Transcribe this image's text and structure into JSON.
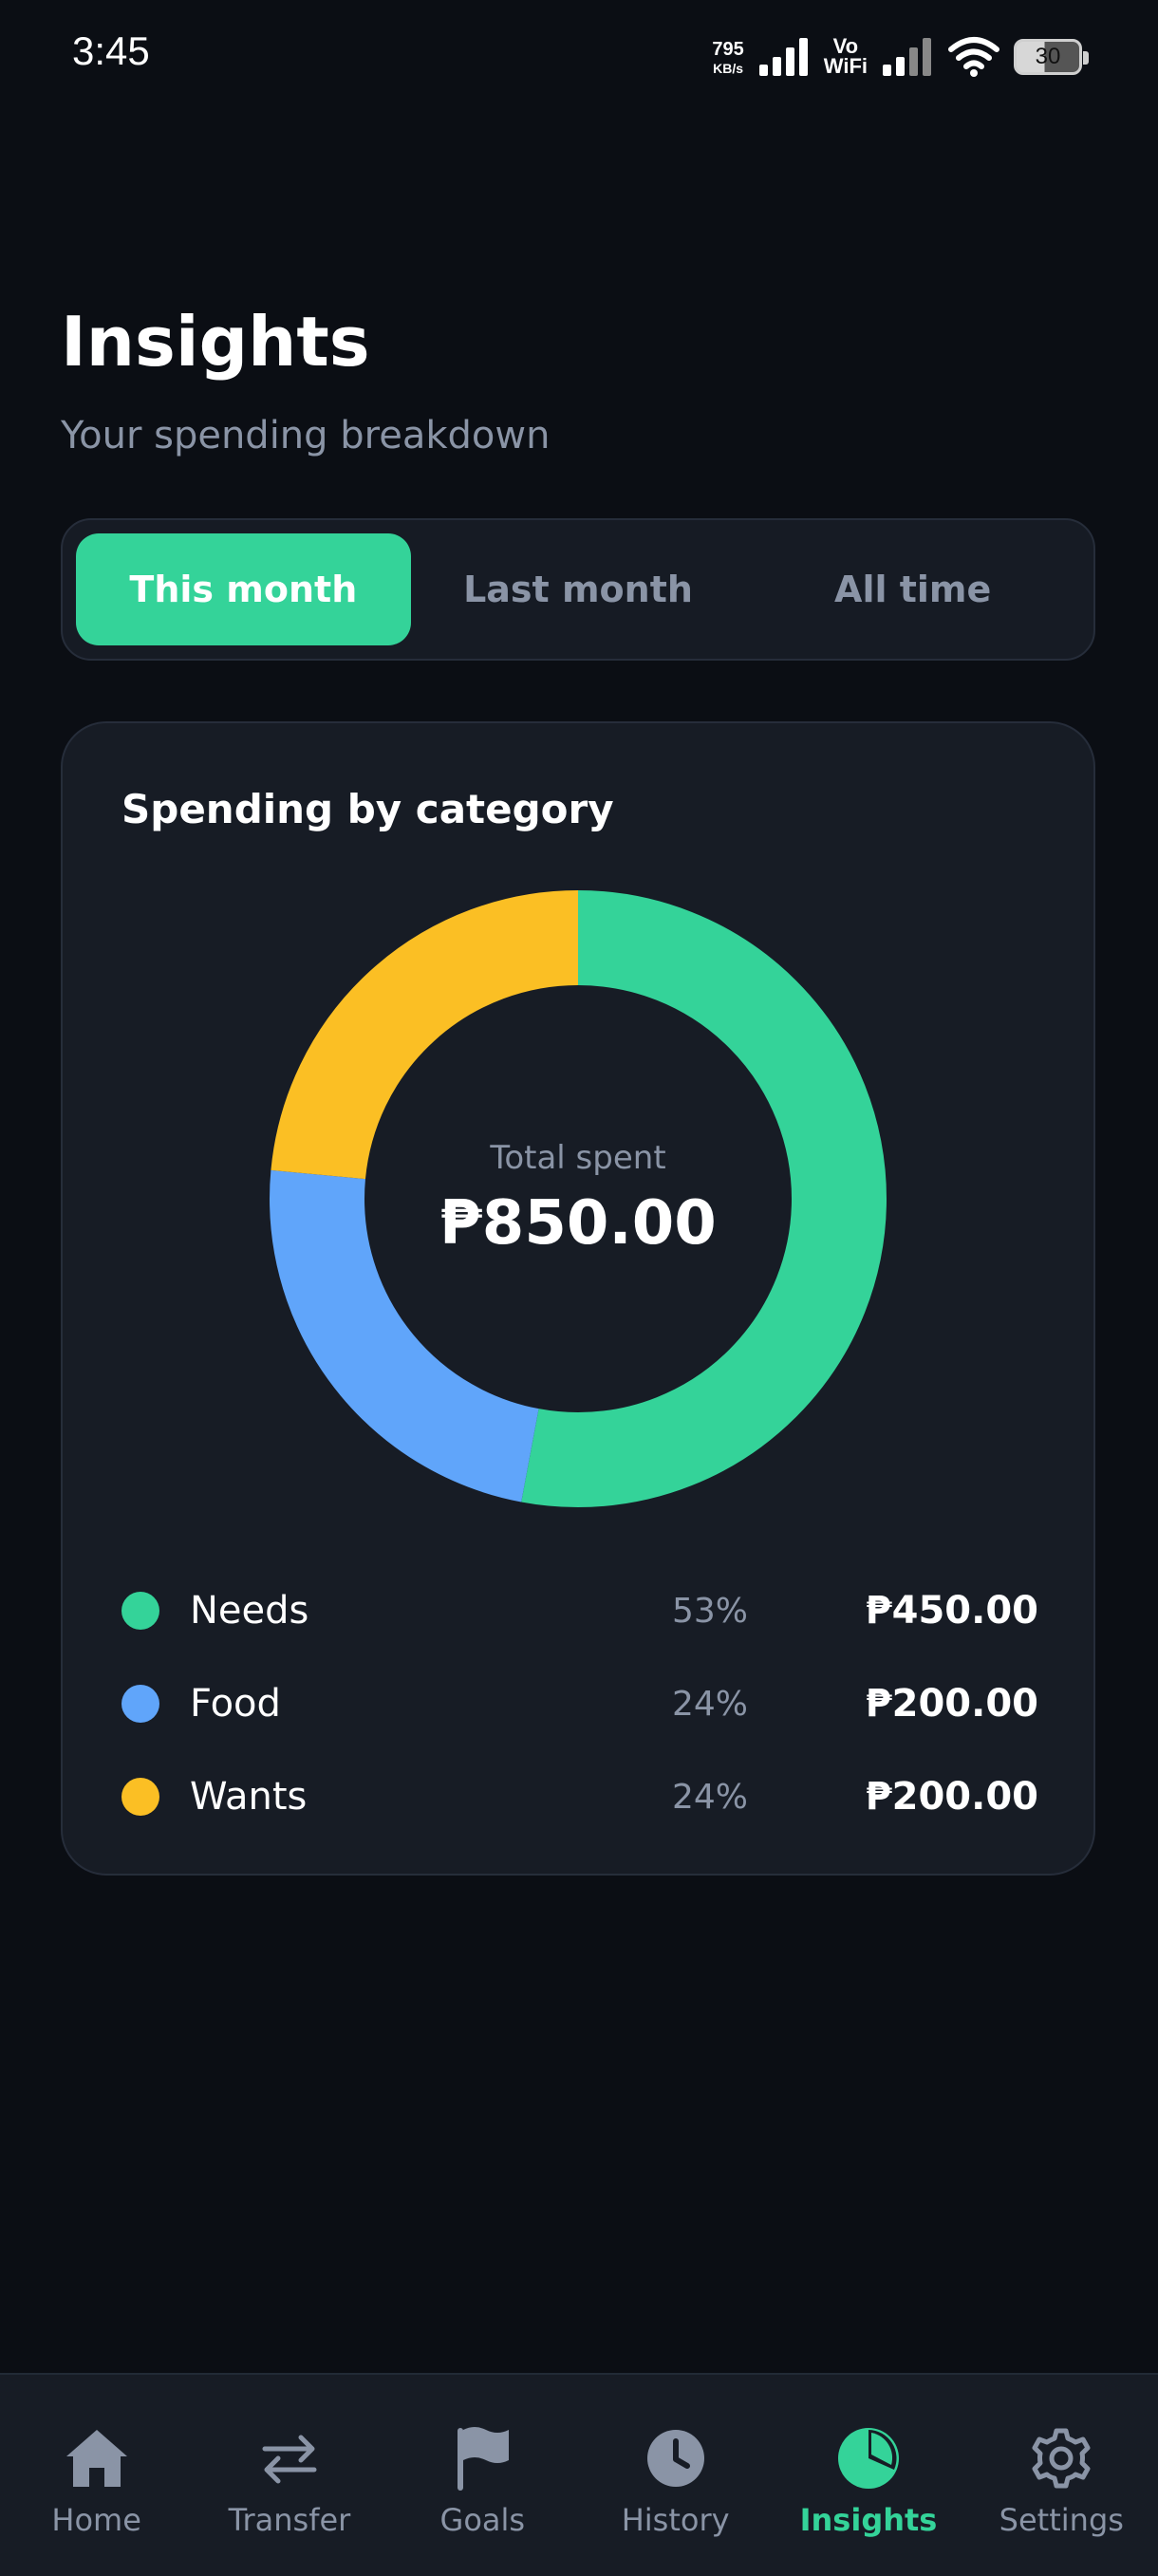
{
  "status_bar": {
    "time": "3:45",
    "net_speed": "795",
    "net_unit": "KB/s",
    "vowifi_top": "Vo",
    "vowifi_bottom": "WiFi",
    "battery": "30"
  },
  "header": {
    "title": "Insights",
    "subtitle": "Your spending breakdown"
  },
  "period_tabs": [
    {
      "label": "This month",
      "active": true
    },
    {
      "label": "Last month",
      "active": false
    },
    {
      "label": "All time",
      "active": false
    }
  ],
  "spending_card": {
    "title": "Spending by category",
    "total_label": "Total spent",
    "total_value": "₱850.00",
    "categories": [
      {
        "label": "Needs",
        "percent": "53%",
        "amount": "₱450.00",
        "value": 450,
        "color": "#34d399"
      },
      {
        "label": "Food",
        "percent": "24%",
        "amount": "₱200.00",
        "value": 200,
        "color": "#60a5fa"
      },
      {
        "label": "Wants",
        "percent": "24%",
        "amount": "₱200.00",
        "value": 200,
        "color": "#fbbf24"
      }
    ]
  },
  "bottom_nav": [
    {
      "label": "Home",
      "icon": "home-icon",
      "active": false
    },
    {
      "label": "Transfer",
      "icon": "transfer-icon",
      "active": false
    },
    {
      "label": "Goals",
      "icon": "flag-icon",
      "active": false
    },
    {
      "label": "History",
      "icon": "clock-icon",
      "active": false
    },
    {
      "label": "Insights",
      "icon": "pie-chart-icon",
      "active": true
    },
    {
      "label": "Settings",
      "icon": "gear-icon",
      "active": false
    }
  ],
  "colors": {
    "accent": "#34d399",
    "background": "#0b0e14",
    "card": "#171c25",
    "muted_text": "#8a94a6"
  }
}
